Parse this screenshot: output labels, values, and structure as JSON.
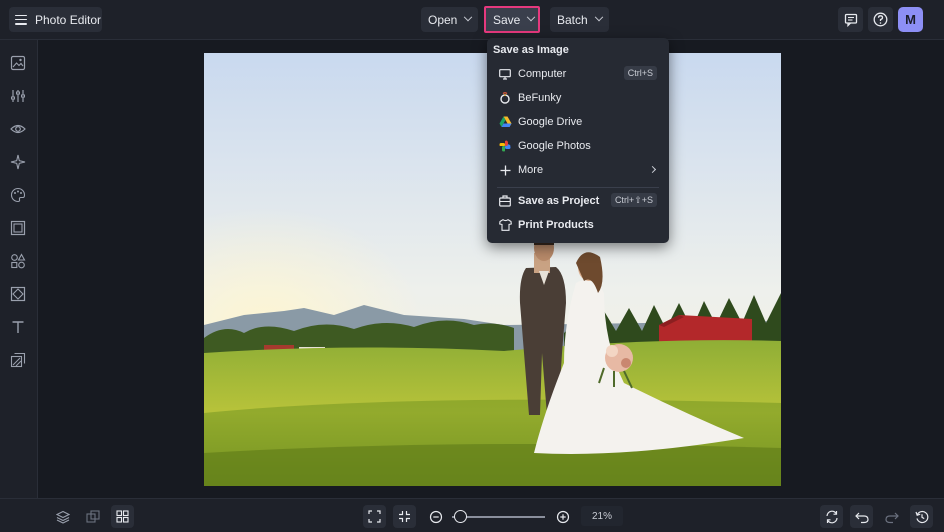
{
  "app": {
    "title": "Photo Editor"
  },
  "toolbar": {
    "open_label": "Open",
    "save_label": "Save",
    "batch_label": "Batch",
    "avatar_initial": "M"
  },
  "save_menu": {
    "header": "Save as Image",
    "items": [
      {
        "label": "Computer",
        "shortcut": "Ctrl+S",
        "icon": "monitor-icon"
      },
      {
        "label": "BeFunky",
        "icon": "befunky-icon"
      },
      {
        "label": "Google Drive",
        "icon": "google-drive-icon"
      },
      {
        "label": "Google Photos",
        "icon": "google-photos-icon"
      },
      {
        "label": "More",
        "icon": "plus-icon"
      }
    ],
    "project_items": [
      {
        "label": "Save as Project",
        "shortcut": "Ctrl+⇧+S",
        "icon": "briefcase-icon"
      },
      {
        "label": "Print Products",
        "icon": "tshirt-icon"
      }
    ]
  },
  "zoom": {
    "value": "21%",
    "level": 0.02
  },
  "colors": {
    "accent": "#8d8ff5",
    "highlight": "#e6397e",
    "background": "#171a21",
    "panel": "#1e2129"
  }
}
